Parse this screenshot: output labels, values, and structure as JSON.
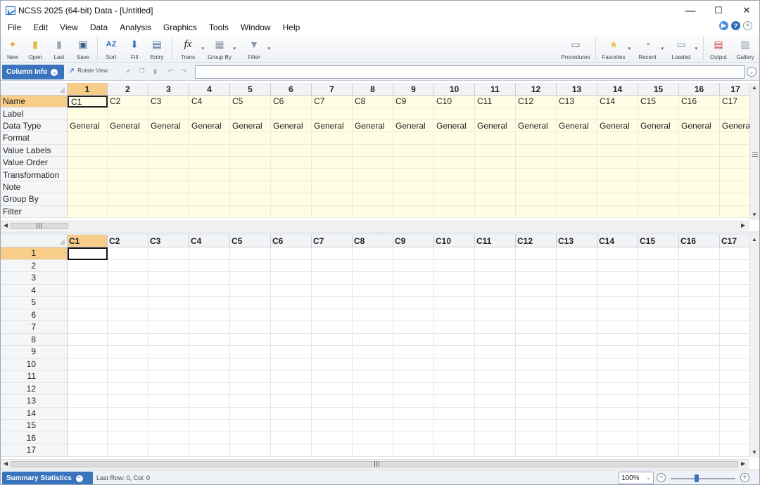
{
  "window": {
    "title": "NCSS 2025 (64-bit) Data - [Untitled]",
    "minimize": "—",
    "maximize": "☐",
    "close": "✕"
  },
  "menu": [
    "File",
    "Edit",
    "View",
    "Data",
    "Analysis",
    "Graphics",
    "Tools",
    "Window",
    "Help"
  ],
  "toolbar": {
    "new": "New",
    "open": "Open",
    "last": "Last",
    "save": "Save",
    "sort": "Sort",
    "fill": "Fill",
    "entry": "Entry",
    "trans": "Trans",
    "group_by": "Group By",
    "filter": "Filter",
    "procedures": "Procedures",
    "favorites": "Favorites",
    "recent": "Recent",
    "loaded": "Loaded",
    "output": "Output",
    "gallery": "Gallery"
  },
  "bar2": {
    "column_info": "Column Info",
    "rotate_view": "Rotate View",
    "formula_value": ""
  },
  "column_info": {
    "col_numbers": [
      "1",
      "2",
      "3",
      "4",
      "5",
      "6",
      "7",
      "8",
      "9",
      "10",
      "11",
      "12",
      "13",
      "14",
      "15",
      "16",
      "17"
    ],
    "row_labels": [
      "Name",
      "Label",
      "Data Type",
      "Format",
      "Value Labels",
      "Value Order",
      "Transformation",
      "Note",
      "Group By",
      "Filter"
    ],
    "names": [
      "C1",
      "C2",
      "C3",
      "C4",
      "C5",
      "C6",
      "C7",
      "C8",
      "C9",
      "C10",
      "C11",
      "C12",
      "C13",
      "C14",
      "C15",
      "C16",
      "C17"
    ],
    "data_types": [
      "General",
      "General",
      "General",
      "General",
      "General",
      "General",
      "General",
      "General",
      "General",
      "General",
      "General",
      "General",
      "General",
      "General",
      "General",
      "General",
      "General"
    ]
  },
  "data_grid": {
    "columns": [
      "C1",
      "C2",
      "C3",
      "C4",
      "C5",
      "C6",
      "C7",
      "C8",
      "C9",
      "C10",
      "C11",
      "C12",
      "C13",
      "C14",
      "C15",
      "C16",
      "C17"
    ],
    "rows": [
      "1",
      "2",
      "3",
      "4",
      "5",
      "6",
      "7",
      "8",
      "9",
      "10",
      "11",
      "12",
      "13",
      "14",
      "15",
      "16",
      "17"
    ]
  },
  "status": {
    "summary_statistics": "Summary Statistics",
    "last_row": "Last Row: 0, Col: 0",
    "zoom": "100%",
    "zoom_level": 100
  }
}
